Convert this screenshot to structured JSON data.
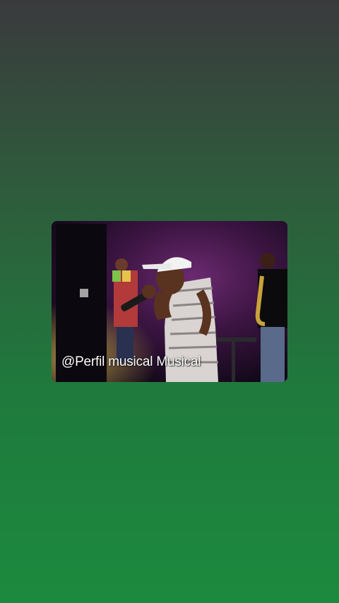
{
  "video": {
    "watermark": "@Perfil musical Musical"
  },
  "colors": {
    "background_top": "#3a3a3d",
    "background_bottom": "#1c8a3e",
    "stage_light": "#7a2a7a"
  }
}
